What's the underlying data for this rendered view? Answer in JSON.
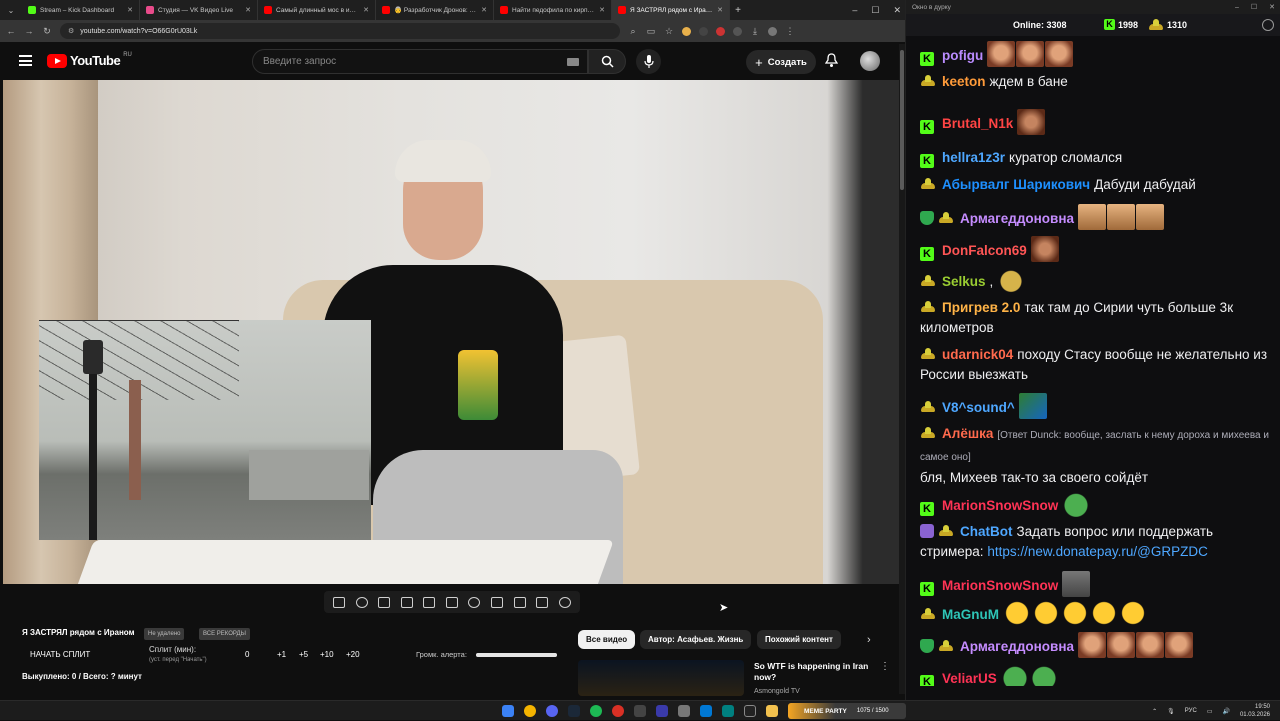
{
  "browser": {
    "tabs": [
      {
        "title": "Stream – Kick Dashboard",
        "color": "#53fc18",
        "active": false
      },
      {
        "title": "Студия — VK Видео Live",
        "color": "#e94b8a",
        "active": false
      },
      {
        "title": "Самый длинный мос в истори...",
        "color": "#ff0000",
        "active": false
      },
      {
        "title": "👵 Разработчик Дронов: вся ...",
        "color": "#ff0000",
        "active": false
      },
      {
        "title": "Найти педофила по кирпичу",
        "color": "#ff0000",
        "active": false
      },
      {
        "title": "Я ЗАСТРЯЛ рядом с Ираном",
        "color": "#ff0000",
        "active": true
      }
    ],
    "url": "youtube.com/watch?v=O66G0rU03Lk"
  },
  "youtube": {
    "logo_text": "YouTube",
    "logo_region": "RU",
    "search_placeholder": "Введите запрос",
    "create_label": "Создать",
    "video_title": "Я ЗАСТРЯЛ рядом с Ираном",
    "tag1": "Не удалено",
    "tag2": "ВСЕ РЕКОРДЫ",
    "split_button": "НАЧАТЬ СПЛИТ",
    "split_label": "Сплит (мин):",
    "split_sub": "(уст. перед \"Начать\")",
    "split_value": "0",
    "increments": [
      "+1",
      "+5",
      "+10",
      "+20"
    ],
    "volume_label": "Громк. алерта:",
    "volume_level": 1.0,
    "done_label": "Выкуплено: 0 / Всего: ? минут",
    "chips": [
      "Все видео",
      "Автор: Асафьев. Жизнь",
      "Похожий контент"
    ],
    "rec_title": "So WTF is happening in Iran now?",
    "rec_channel": "Asmongold TV"
  },
  "chat": {
    "window_title": "Окно в дурку",
    "online_label": "Online:",
    "online_count": "3308",
    "kick_count": "1998",
    "hat_count": "1310",
    "messages": [
      {
        "user": "pofigu",
        "color": "#ba8cff",
        "badge": "kick",
        "text": "",
        "emotes": [
          "face",
          "face",
          "face"
        ]
      },
      {
        "user": "keeton",
        "color": "#ff9b3a",
        "badge": "hat",
        "text": "ждем в бане",
        "emotes": []
      },
      {
        "user": "Brutal_N1k",
        "color": "#ff4444",
        "badge": "kick",
        "text": "",
        "emotes": [
          "brown"
        ]
      },
      {
        "user": "hellra1z3r",
        "color": "#4ea7ff",
        "badge": "kick",
        "text": "куратор сломался",
        "emotes": []
      },
      {
        "user": "Абырвалг Шарикович",
        "color": "#1e90ff",
        "badge": "hat",
        "text": "Дабуди дабудай",
        "emotes": []
      },
      {
        "user": "Армагеддоновна",
        "color": "#c58cff",
        "badge": "shield-hat",
        "text": "",
        "emotes": [
          "hands",
          "hands",
          "hands"
        ]
      },
      {
        "user": "DonFalcon69",
        "color": "#ff5555",
        "badge": "kick",
        "text": "",
        "emotes": [
          "brown"
        ]
      },
      {
        "user": "Selkus",
        "color": "#9acd32",
        "badge": "hat",
        "text": ",",
        "emotes": [
          "cookie"
        ]
      },
      {
        "user": "Пригрев 2.0",
        "color": "#ffb347",
        "badge": "hat",
        "text": "так там до Сирии чуть больше 3к километров",
        "emotes": []
      },
      {
        "user": "udarnick04",
        "color": "#ff6a4d",
        "badge": "hat",
        "text": "походу Стасу вообще не желательно из России выезжать",
        "emotes": []
      },
      {
        "user": "V8^sound^",
        "color": "#4ea7ff",
        "badge": "hat",
        "text": "",
        "emotes": [
          "pepe"
        ]
      },
      {
        "user": "Алёшка",
        "color": "#ff6a4d",
        "badge": "hat",
        "reply": "[Ответ Dunck: вообще, заслать к нему дороха и михеева и самое оно]",
        "text": "бля, Михеев так-то за своего сойдёт",
        "emotes": []
      },
      {
        "user": "MarionSnowSnow",
        "color": "#ff3355",
        "badge": "kick",
        "text": "",
        "emotes": [
          "frog"
        ]
      },
      {
        "user": "ChatBot",
        "color": "#4ea7ff",
        "badge": "bot-hat",
        "text": "Задать вопрос или поддержать стримера:",
        "link": "https://new.donatepay.ru/@GRPZDC",
        "emotes": []
      },
      {
        "user": "MarionSnowSnow",
        "color": "#ff3355",
        "badge": "kick",
        "text": "",
        "emotes": [
          "grey"
        ]
      },
      {
        "user": "MaGnuM",
        "color": "#2ec4b6",
        "badge": "hat",
        "text": "",
        "emotes": [
          "laugh",
          "laugh",
          "laugh",
          "laugh",
          "laugh"
        ]
      },
      {
        "user": "Армагеддоновна",
        "color": "#c58cff",
        "badge": "shield-hat",
        "text": "",
        "emotes": [
          "face",
          "face",
          "face",
          "face"
        ]
      },
      {
        "user": "VeliarUS",
        "color": "#ff3355",
        "badge": "kick",
        "text": "",
        "emotes": [
          "frog",
          "frog"
        ]
      }
    ]
  },
  "taskbar": {
    "meme_title": "MEME PARTY",
    "meme_progress": "1075 / 1500",
    "lang": "РУС",
    "time": "19:50",
    "date": "01.03.2026"
  }
}
